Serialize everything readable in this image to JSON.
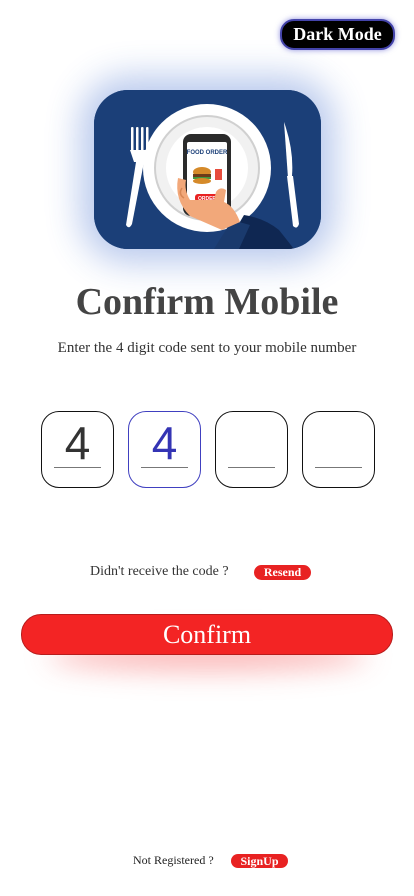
{
  "toggle": {
    "label": "Dark Mode"
  },
  "hero": {
    "screen_label": "FOOD ORDER",
    "order_label": "ORDER"
  },
  "page": {
    "title": "Confirm Mobile",
    "subtitle": "Enter the 4 digit code sent to your mobile number"
  },
  "otp": {
    "digits": [
      "4",
      "4",
      "",
      ""
    ]
  },
  "resend": {
    "prompt": "Didn't receive the code ?",
    "button": "Resend"
  },
  "confirm": {
    "label": "Confirm"
  },
  "signup": {
    "prompt": "Not Registered ?",
    "button": "SignUp"
  },
  "colors": {
    "accent_red": "#f32424",
    "hero_blue": "#1b3f78",
    "active_otp": "#4040c0",
    "toggle_bg": "#000000"
  }
}
